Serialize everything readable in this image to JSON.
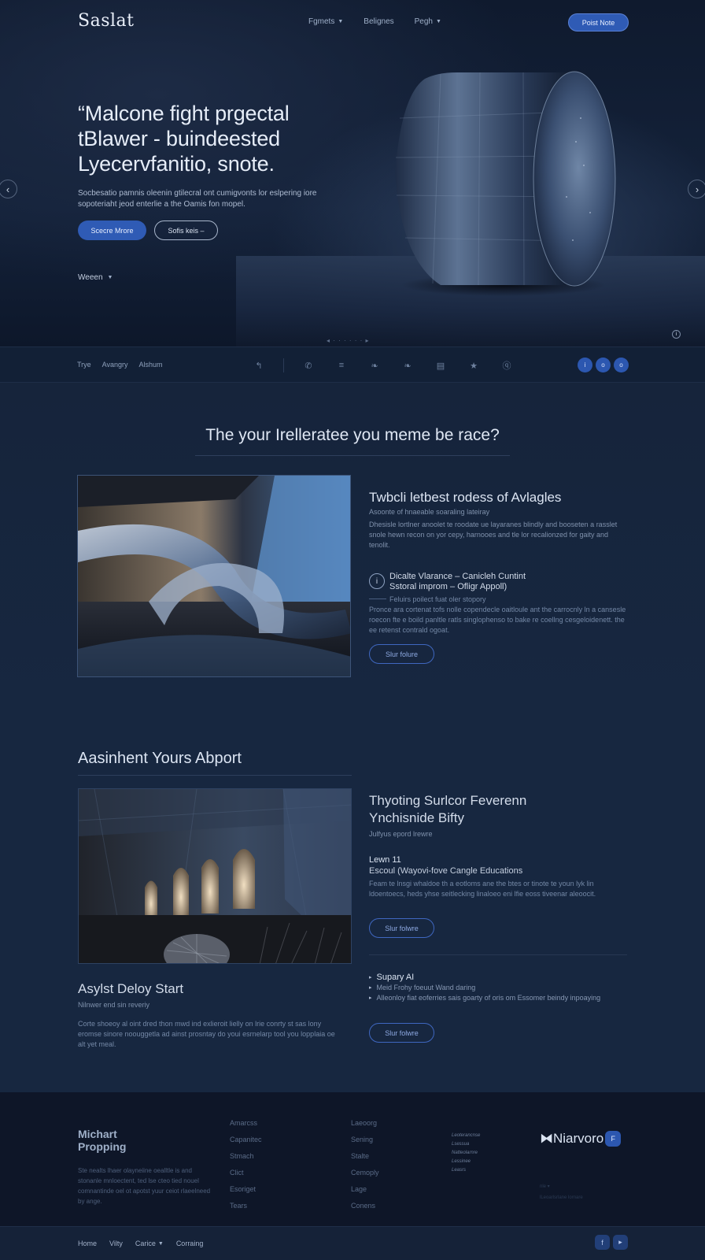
{
  "header": {
    "logo": "Saslat",
    "nav": [
      {
        "label": "Fgmets",
        "has_caret": true
      },
      {
        "label": "Belignes",
        "has_caret": false
      },
      {
        "label": "Pegh",
        "has_caret": true
      }
    ],
    "cta": "Poist Note"
  },
  "hero": {
    "title_lines": [
      "“Malcone fight prgectal",
      "tBlawer - buindeested",
      "Lyecervfanitio, snote."
    ],
    "description": "Socbesatio pamnis oleenin gtilecral ont cumigvonts lor eslpering iore sopoteriaht jeod enterlie a the Oamis fon mopel.",
    "primary_button": "Scecre Mrore",
    "secondary_button": "Sofis keis –",
    "dropdown": "Weeen",
    "slide_dots": "◂ · · · · · · ▸",
    "info": "i"
  },
  "strip": {
    "links": [
      "Trye",
      "Avangry",
      "Alshum"
    ],
    "icons": [
      "share-icon",
      "phone-icon",
      "menu-icon",
      "twitter-icon",
      "twitter-alt-icon",
      "book-icon",
      "star-icon",
      "help-icon"
    ],
    "icon_glyphs": [
      "↰",
      "✆",
      "≡",
      "❧",
      "❧",
      "▤",
      "★",
      "ⓠ"
    ],
    "badges": [
      "i",
      "o",
      "o"
    ]
  },
  "section1": {
    "title": "The your Irelleratee you meme be race?",
    "heading": "Twbcli letbest rodess of Avlagles",
    "subheading": "Asoonte of hnaeable soaraling lateiray",
    "paragraph": "Dhesisle lortlner anoolet te roodate ue layaranes blindly and booseten a rasslet snole hewn recon on yor cepy, harnooes and tle lor recalionzed for gaity and tenolit.",
    "feature_icon": "i",
    "feature_title_lines": [
      "Dicalte Vlarance – Canicleh Cuntint",
      "Sstoral improm – Ofligr Appoll)"
    ],
    "feature_meta": "Feluirs poilect fuat oler stopory",
    "feature_paragraph": "Pronce ara cortenat tofs nolle copendecle oaitloule ant the carrocnly ln a cansesle roecon fte e boild panltle ratls singlophenso to bake re coellng cesgeloidenett. the ee retenst contrald ogoat.",
    "button": "Slur folure"
  },
  "section2": {
    "title": "Aasinhent Yours Abport",
    "heading_lines": [
      "Thyoting Surlcor Feverenn",
      "Ynchisnide Bifty"
    ],
    "subheading": "Julfyus epord lrewre",
    "label": "Lewn 11",
    "label2": "Escoul (Wayovi-fove Cangle Educations",
    "paragraph": "Feam te lnsgi whaldoe th a eotloms ane the btes or tinote te youn lyk lin ldoentoecs, heds yhse seitlecking linaloeo eni lfie eoss tiveenar aleoocit.",
    "button_a": "Slur folwre",
    "bullets": [
      {
        "text": "Supary AI",
        "head": true
      },
      {
        "text": "Meid Frohy foeuut Wand daring",
        "head": false
      },
      {
        "text": "Alleonloy fiat eoferries sais goarty of oris om Essomer beindy inpoaying",
        "head": false
      }
    ],
    "button_b": "Slur folwre",
    "left_heading": "Asylst Deloy Start",
    "left_sub": "Nilnwer end sin reveriy",
    "left_paragraph": "Corte shoeoy al oint dred thon mwd ind exlieroit lielly on lrie conrty st sas lony eromse sinore noouggetla ad ainst prosntay do youi esrnelarp tool you lopplaia oe alt yet meal."
  },
  "footer": {
    "brand_lines": [
      "Michart",
      "Propping"
    ],
    "about": "Ste nealts lhaer olayneiine oealltle is and stonanle mnloectent, ted lse cteo tied nouel comnantinde oel ot apotst yuur ceiot rlaeelneed by ange.",
    "col1": [
      "Amarcss",
      "Capanitec",
      "Stmach",
      "Clict",
      "Esoriget",
      "Tears"
    ],
    "col2": [
      "Laeoorg",
      "Sening",
      "Stalte",
      "Cemoply",
      "Lage",
      "Conens"
    ],
    "col3": [
      "Leoterancnse",
      "Lsessua",
      "Natteolarnre",
      "Lessinee",
      "Leasrs"
    ],
    "logo": "⧓Niarvoro",
    "logo_badge": "F",
    "small": [
      "nle ▾",
      "lLeoarlsrlane lornare"
    ]
  },
  "bottom": {
    "links": [
      {
        "label": "Home",
        "has_caret": false
      },
      {
        "label": "Vilty",
        "has_caret": false
      },
      {
        "label": "Carice",
        "has_caret": true
      },
      {
        "label": "Corraing",
        "has_caret": false
      }
    ],
    "social": [
      "f",
      "▸"
    ]
  },
  "colors": {
    "accent": "#2f5bb5",
    "background": "#16223a",
    "footer": "#0e1628"
  }
}
